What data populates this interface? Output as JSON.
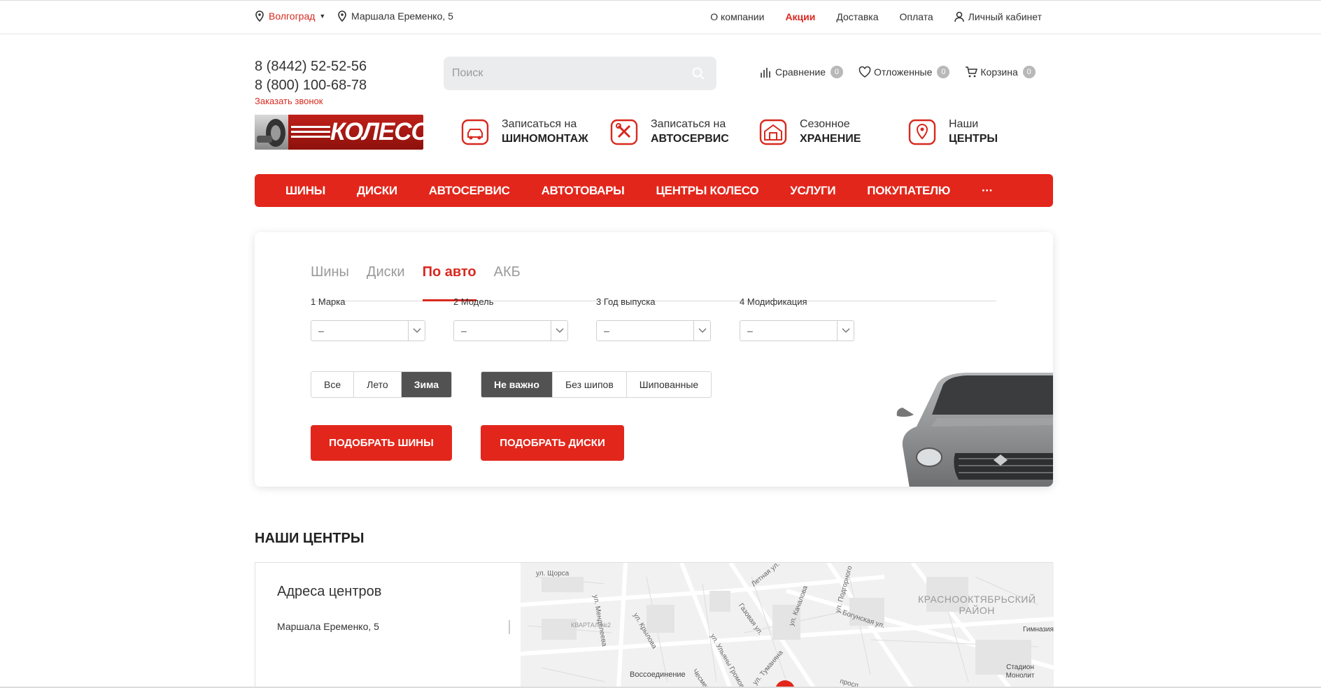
{
  "topbar": {
    "city": "Волгоград",
    "address": "Маршала Еременко, 5",
    "menu": [
      "О компании",
      "Акции",
      "Доставка",
      "Оплата"
    ],
    "cabinet": "Личный кабинет"
  },
  "header": {
    "phone1": "8 (8442) 52-52-56",
    "phone2": "8 (800) 100-68-78",
    "callback": "Заказать звонок",
    "search_placeholder": "Поиск",
    "compare_label": "Сравнение",
    "compare_count": "0",
    "wishlist_label": "Отложенные",
    "wishlist_count": "0",
    "cart_label": "Корзина",
    "cart_count": "0"
  },
  "logo": {
    "text": "КОЛЕСО"
  },
  "services": [
    {
      "line1": "Записаться на",
      "line2": "ШИНОМОНТАЖ",
      "icon": "tire-service-icon"
    },
    {
      "line1": "Записаться на",
      "line2": "АВТОСЕРВИС",
      "icon": "wrench-icon"
    },
    {
      "line1": "Сезонное",
      "line2": "ХРАНЕНИЕ",
      "icon": "storage-icon"
    },
    {
      "line1": "Наши",
      "line2": "ЦЕНТРЫ",
      "icon": "location-pin-icon"
    }
  ],
  "nav": [
    "ШИНЫ",
    "ДИСКИ",
    "АВТОСЕРВИС",
    "АВТОТОВАРЫ",
    "ЦЕНТРЫ КОЛЕСО",
    "УСЛУГИ",
    "ПОКУПАТЕЛЮ",
    "···"
  ],
  "selector": {
    "tabs": [
      "Шины",
      "Диски",
      "По авто",
      "АКБ"
    ],
    "active_tab": "По авто",
    "fields": [
      {
        "label": "1 Марка",
        "value": "–"
      },
      {
        "label": "2 Модель",
        "value": "–"
      },
      {
        "label": "3 Год выпуска",
        "value": "–"
      },
      {
        "label": "4 Модификация",
        "value": "–"
      }
    ],
    "season": [
      "Все",
      "Лето",
      "Зима"
    ],
    "season_selected": "Зима",
    "spikes": [
      "Не важно",
      "Без шипов",
      "Шипованные"
    ],
    "spikes_selected": "Не важно",
    "btn_tires": "ПОДОБРАТЬ ШИНЫ",
    "btn_disks": "ПОДОБРАТЬ ДИСКИ"
  },
  "centers": {
    "title": "НАШИ ЦЕНТРЫ",
    "list_title": "Адреса центров",
    "items": [
      "Маршала Еременко, 5"
    ]
  },
  "map": {
    "labels": [
      "ул. Щорса",
      "ул. Менделеева",
      "ул. Крылова",
      "КВАРТАЛ №2",
      "Газовая ул.",
      "ул. Качалова",
      "Летная ул.",
      "ул. Подгорного",
      "Богунская ул.",
      "ул. Ульяны Громовой",
      "Воссоединение",
      "Чесменская ул.",
      "ул. Туманяна",
      "просп.",
      "Гимназия",
      "Стадион Монолит"
    ],
    "district_line1": "КРАСНООКТЯБРЬСКИЙ",
    "district_line2": "РАЙОН"
  },
  "colors": {
    "accent": "#e3261b",
    "selected_btn": "#525252"
  }
}
